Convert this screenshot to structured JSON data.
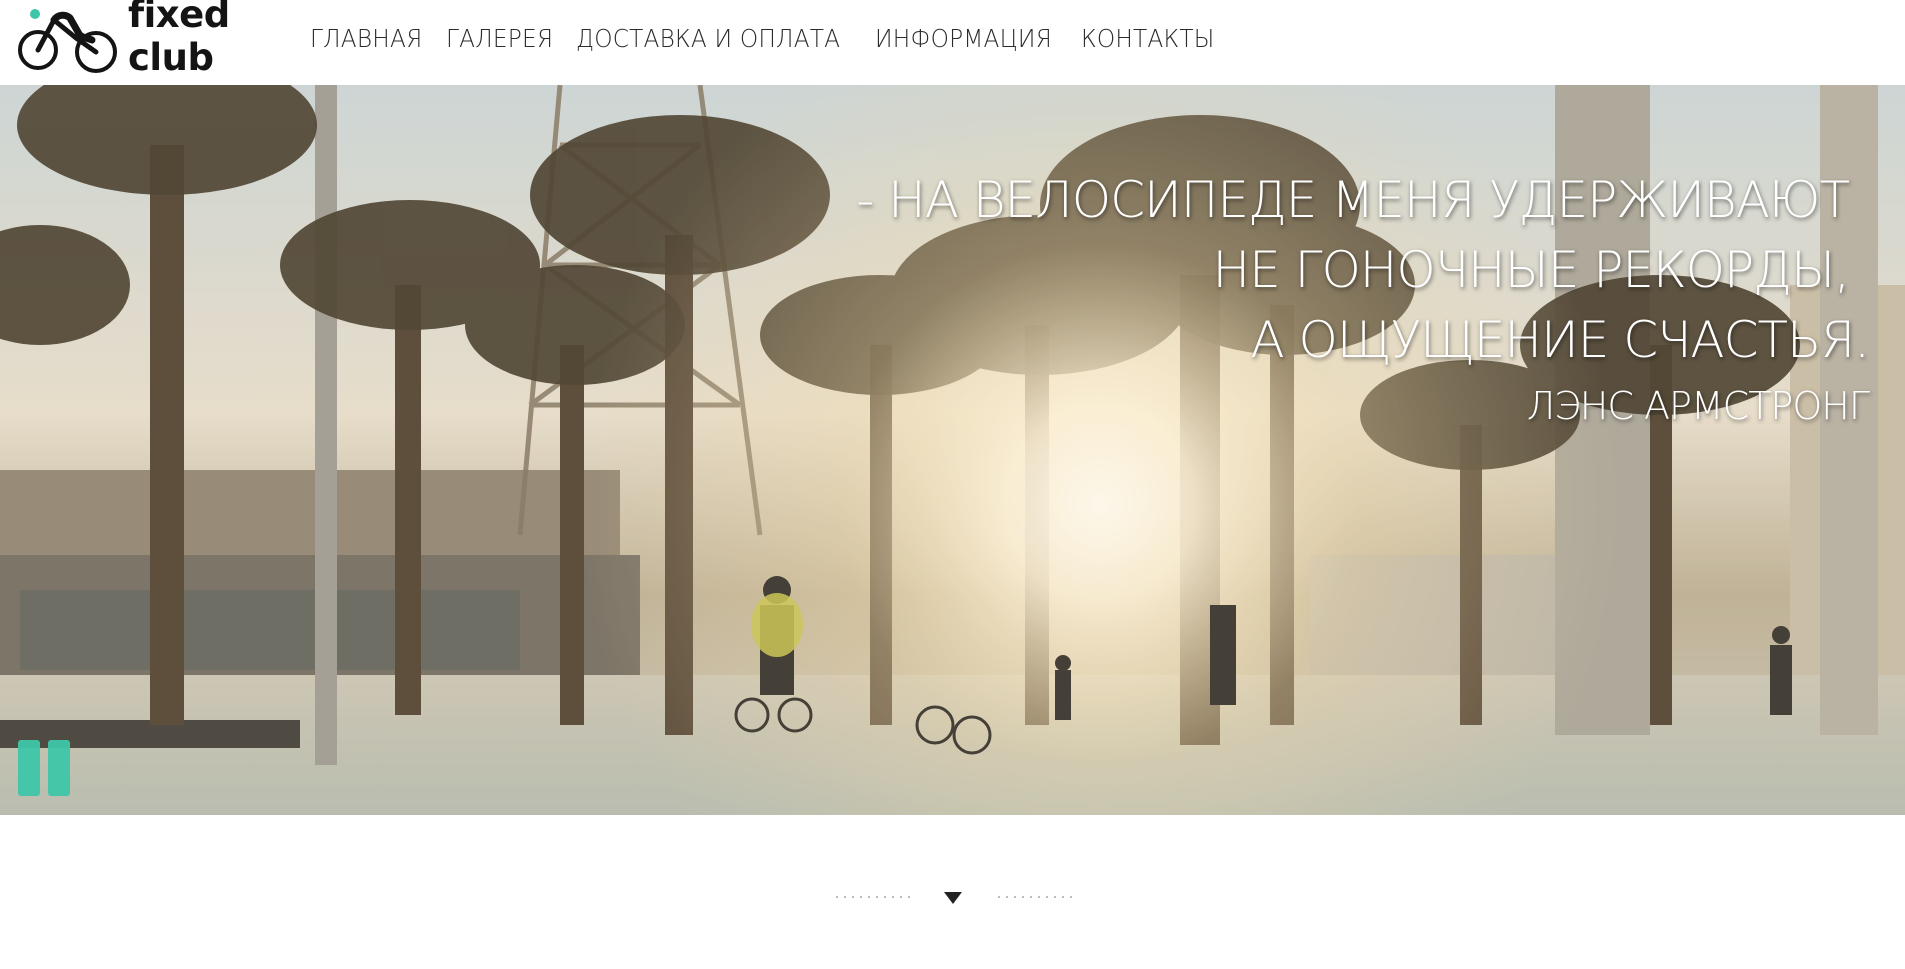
{
  "header": {
    "logo_text": "fixed club",
    "brand_color": "#3ec6a8",
    "nav": [
      {
        "label": "ГЛАВНАЯ"
      },
      {
        "label": "ГАЛЕРЕЯ"
      },
      {
        "label": "ДОСТАВКА И ОПЛАТА"
      },
      {
        "label": "ИНФОРМАЦИЯ"
      },
      {
        "label": "КОНТАКТЫ"
      }
    ]
  },
  "hero": {
    "quote_lines": [
      "- НА ВЕЛОСИПЕДЕ МЕНЯ УДЕРЖИВАЮТ",
      "НЕ ГОНОЧНЫЕ РЕКОРДЫ,",
      "А ОЩУЩЕНИЕ СЧАСТЬЯ."
    ],
    "author": "ЛЭНС АРМСТРОНГ",
    "pause_icon": "pause-icon",
    "accent_color": "#3ec6a8"
  },
  "scroll": {
    "icon": "chevron-down-icon"
  }
}
